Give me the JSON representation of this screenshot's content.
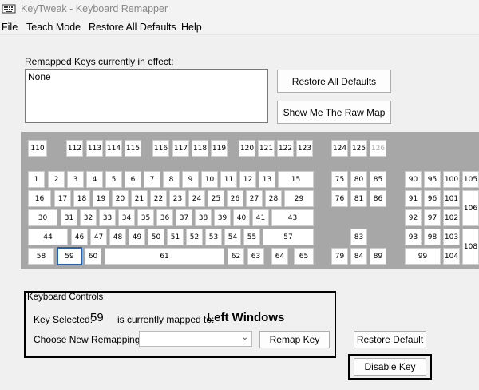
{
  "window": {
    "title": "KeyTweak -  Keyboard Remapper"
  },
  "menu": [
    "File",
    "Teach Mode",
    "Restore All Defaults",
    "Help"
  ],
  "remapped": {
    "label": "Remapped Keys currently in effect:",
    "value": "None"
  },
  "buttons": {
    "restore_all": "Restore All Defaults",
    "raw_map": "Show Me The Raw Map",
    "remap_key": "Remap Key",
    "restore_default": "Restore Default",
    "disable_key": "Disable Key"
  },
  "keyboard_controls": {
    "title": "Keyboard Controls",
    "key_selected_label": "Key Selected:",
    "key_selected_value": "59",
    "mapped_label": "is currently mapped to:",
    "mapped_value": "Left Windows",
    "choose_label": "Choose New Remapping",
    "combo_value": ""
  },
  "keyboard": {
    "selected_key": "59",
    "disabled_keys": [
      "126"
    ],
    "keys": [
      "110",
      "112",
      "113",
      "114",
      "115",
      "116",
      "117",
      "118",
      "119",
      "120",
      "121",
      "122",
      "123",
      "124",
      "125",
      "126",
      "1",
      "2",
      "3",
      "4",
      "5",
      "6",
      "7",
      "8",
      "9",
      "10",
      "11",
      "12",
      "13",
      "15",
      "75",
      "80",
      "85",
      "90",
      "95",
      "100",
      "105",
      "16",
      "17",
      "18",
      "19",
      "20",
      "21",
      "22",
      "23",
      "24",
      "25",
      "26",
      "27",
      "28",
      "29",
      "76",
      "81",
      "86",
      "91",
      "96",
      "101",
      "106",
      "30",
      "31",
      "32",
      "33",
      "34",
      "35",
      "36",
      "37",
      "38",
      "39",
      "40",
      "41",
      "43",
      "92",
      "97",
      "102",
      "44",
      "46",
      "47",
      "48",
      "49",
      "50",
      "51",
      "52",
      "53",
      "54",
      "55",
      "57",
      "83",
      "93",
      "98",
      "103",
      "108",
      "58",
      "59",
      "60",
      "61",
      "62",
      "63",
      "64",
      "65",
      "79",
      "84",
      "89",
      "99",
      "104"
    ]
  }
}
